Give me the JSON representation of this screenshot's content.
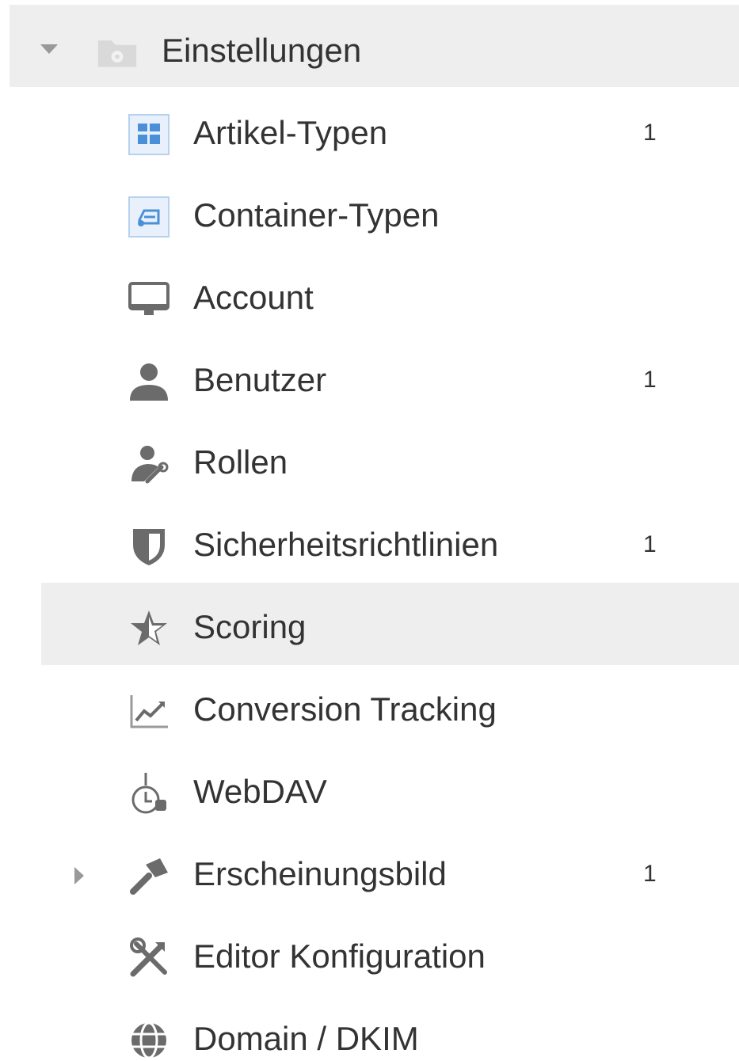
{
  "tree": {
    "root": {
      "label": "Einstellungen",
      "expanded": true,
      "icon": "folder-settings-icon"
    },
    "items": [
      {
        "label": "Artikel-Typen",
        "count": "1",
        "icon": "article-types-icon"
      },
      {
        "label": "Container-Typen",
        "count": "",
        "icon": "container-types-icon"
      },
      {
        "label": "Account",
        "count": "",
        "icon": "monitor-icon"
      },
      {
        "label": "Benutzer",
        "count": "1",
        "icon": "user-icon"
      },
      {
        "label": "Rollen",
        "count": "",
        "icon": "user-wrench-icon"
      },
      {
        "label": "Sicherheitsrichtlinien",
        "count": "1",
        "icon": "shield-icon"
      },
      {
        "label": "Scoring",
        "count": "",
        "icon": "star-icon",
        "selected": true
      },
      {
        "label": "Conversion Tracking",
        "count": "",
        "icon": "line-chart-icon"
      },
      {
        "label": "WebDAV",
        "count": "",
        "icon": "webdav-icon"
      },
      {
        "label": "Erscheinungsbild",
        "count": "1",
        "icon": "hammer-icon",
        "collapsed": true
      },
      {
        "label": "Editor Konfiguration",
        "count": "",
        "icon": "tools-icon"
      },
      {
        "label": "Domain / DKIM",
        "count": "",
        "icon": "globe-icon"
      }
    ]
  },
  "colors": {
    "selected_background": "#eeeeee",
    "text": "#333333",
    "icon_gray": "#6b6b6b",
    "icon_blue": "#4a90d9"
  }
}
